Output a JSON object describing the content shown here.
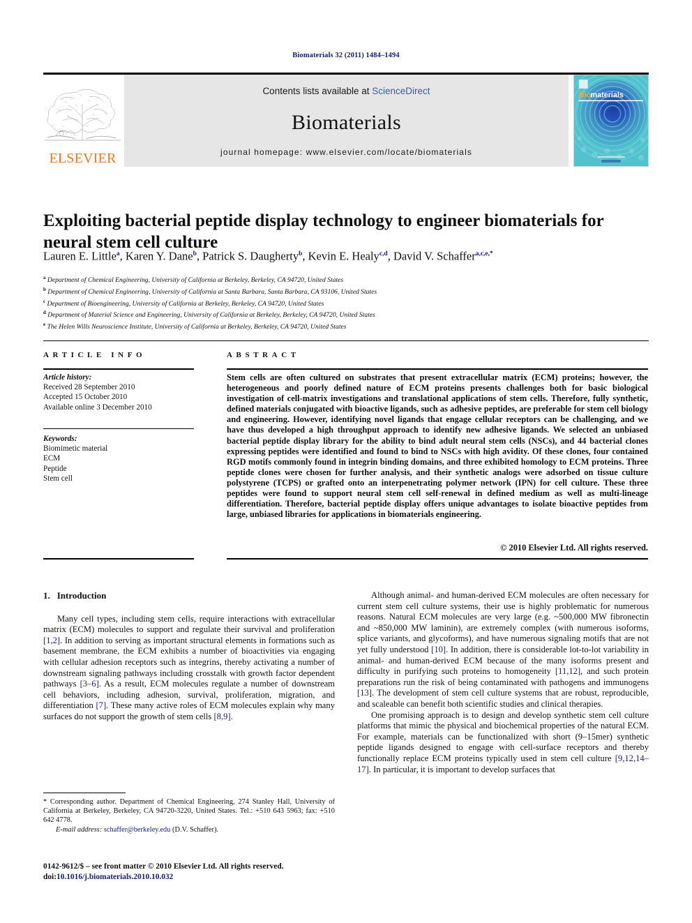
{
  "running_head": "Biomaterials 32 (2011) 1484–1494",
  "masthead": {
    "contents_prefix": "Contents lists available at ",
    "sciencedirect": "ScienceDirect",
    "journal_title": "Biomaterials",
    "homepage": "journal homepage: www.elsevier.com/locate/biomaterials",
    "publisher_name": "ELSEVIER",
    "cover_title_1": "Bio",
    "cover_title_2": "materials",
    "accent_orange": "#ee7622",
    "accent_blue": "#3b5ca8",
    "band_gray": "#e6e6e6",
    "cover_teal": "#2fa8b8"
  },
  "title": "Exploiting bacterial peptide display technology to engineer biomaterials for neural stem cell culture",
  "authors": [
    {
      "name": "Lauren E. Little",
      "sup": "a",
      "sep": ", "
    },
    {
      "name": "Karen Y. Dane",
      "sup": "b",
      "sep": ", "
    },
    {
      "name": "Patrick S. Daugherty",
      "sup": "b",
      "sep": ", "
    },
    {
      "name": "Kevin E. Healy",
      "sup": "c,d",
      "sep": ", "
    },
    {
      "name": "David V. Schaffer",
      "sup": "a,c,e,*",
      "sep": ""
    }
  ],
  "affiliations": [
    {
      "sup": "a",
      "text": "Department of Chemical Engineering, University of California at Berkeley, Berkeley, CA 94720, United States"
    },
    {
      "sup": "b",
      "text": "Department of Chemical Engineering, University of California at Santa Barbara, Santa Barbara, CA 93106, United States"
    },
    {
      "sup": "c",
      "text": "Department of Bioengineering, University of California at Berkeley, Berkeley, CA 94720, United States"
    },
    {
      "sup": "d",
      "text": "Department of Material Science and Engineering, University of California at Berkeley, Berkeley, CA 94720, United States"
    },
    {
      "sup": "e",
      "text": "The Helen Wills Neuroscience Institute, University of California at Berkeley, Berkeley, CA 94720, United States"
    }
  ],
  "article_info": {
    "heading": "ARTICLE INFO",
    "history_label": "Article history:",
    "history": [
      "Received 28 September 2010",
      "Accepted 15 October 2010",
      "Available online 3 December 2010"
    ],
    "keywords_label": "Keywords:",
    "keywords": [
      "Biomimetic material",
      "ECM",
      "Peptide",
      "Stem cell"
    ]
  },
  "abstract": {
    "heading": "ABSTRACT",
    "text": "Stem cells are often cultured on substrates that present extracellular matrix (ECM) proteins; however, the heterogeneous and poorly defined nature of ECM proteins presents challenges both for basic biological investigation of cell-matrix investigations and translational applications of stem cells. Therefore, fully synthetic, defined materials conjugated with bioactive ligands, such as adhesive peptides, are preferable for stem cell biology and engineering. However, identifying novel ligands that engage cellular receptors can be challenging, and we have thus developed a high throughput approach to identify new adhesive ligands. We selected an unbiased bacterial peptide display library for the ability to bind adult neural stem cells (NSCs), and 44 bacterial clones expressing peptides were identified and found to bind to NSCs with high avidity. Of these clones, four contained RGD motifs commonly found in integrin binding domains, and three exhibited homology to ECM proteins. Three peptide clones were chosen for further analysis, and their synthetic analogs were adsorbed on tissue culture polystyrene (TCPS) or grafted onto an interpenetrating polymer network (IPN) for cell culture. These three peptides were found to support neural stem cell self-renewal in defined medium as well as multi-lineage differentiation. Therefore, bacterial peptide display offers unique advantages to isolate bioactive peptides from large, unbiased libraries for applications in biomaterials engineering.",
    "copyright": "© 2010 Elsevier Ltd. All rights reserved."
  },
  "body": {
    "section_number": "1.",
    "section_title": "Introduction",
    "left_paragraphs": [
      "Many cell types, including stem cells, require interactions with extracellular matrix (ECM) molecules to support and regulate their survival and proliferation [1,2]. In addition to serving as important structural elements in formations such as basement membrane, the ECM exhibits a number of bioactivities via engaging with cellular adhesion receptors such as integrins, thereby activating a number of downstream signaling pathways including crosstalk with growth factor dependent pathways [3–6]. As a result, ECM molecules regulate a number of downstream cell behaviors, including adhesion, survival, proliferation, migration, and differentiation [7]. These many active roles of ECM molecules explain why many surfaces do not support the growth of stem cells [8,9]."
    ],
    "right_paragraphs": [
      "Although animal- and human-derived ECM molecules are often necessary for current stem cell culture systems, their use is highly problematic for numerous reasons. Natural ECM molecules are very large (e.g. ~500,000 MW fibronectin and ~850,000 MW laminin), are extremely complex (with numerous isoforms, splice variants, and glycoforms), and have numerous signaling motifs that are not yet fully understood [10]. In addition, there is considerable lot-to-lot variability in animal- and human-derived ECM because of the many isoforms present and difficulty in purifying such proteins to homogeneity [11,12], and such protein preparations run the risk of being contaminated with pathogens and immunogens [13]. The development of stem cell culture systems that are robust, reproducible, and scaleable can benefit both scientific studies and clinical therapies.",
      "One promising approach is to design and develop synthetic stem cell culture platforms that mimic the physical and biochemical properties of the natural ECM. For example, materials can be functionalized with short (9–15mer) synthetic peptide ligands designed to engage with cell-surface receptors and thereby functionally replace ECM proteins typically used in stem cell culture [9,12,14–17]. In particular, it is important to develop surfaces that"
    ]
  },
  "footnote": {
    "marker": "*",
    "corresponding": "Corresponding author. Department of Chemical Engineering, 274 Stanley Hall, University of California at Berkeley, Berkeley, CA 94720-3220, United States. Tel.: +510 643 5963; fax: +510 642 4778.",
    "email_label": "E-mail address:",
    "email": "schaffer@berkeley.edu",
    "email_owner": "(D.V. Schaffer)."
  },
  "imprint": {
    "issn_line": "0142-9612/$ – see front matter © 2010 Elsevier Ltd. All rights reserved.",
    "doi_label": "doi:",
    "doi": "10.1016/j.biomaterials.2010.10.032"
  }
}
